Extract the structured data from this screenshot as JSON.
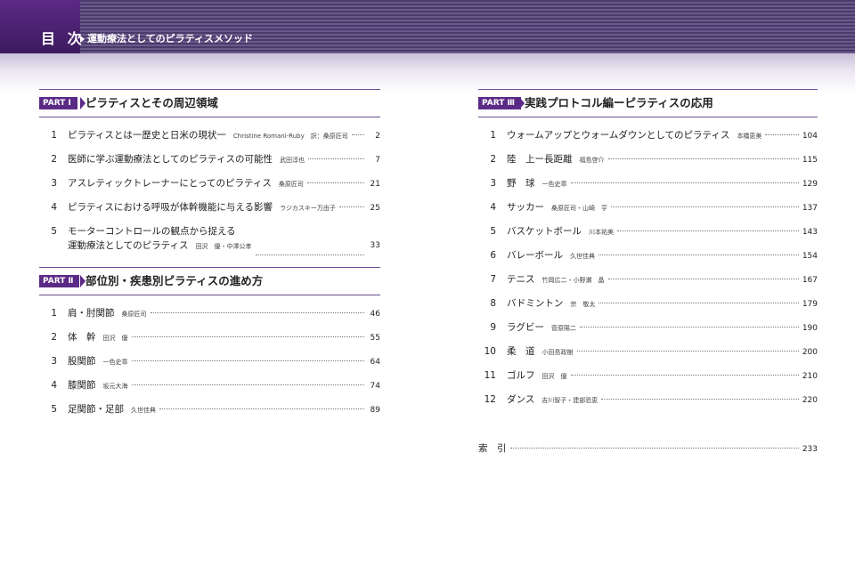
{
  "header": {
    "title": "目 次",
    "subtitle": "運動療法としてのピラティスメソッド"
  },
  "parts": {
    "p1": {
      "badge": "PART Ⅰ",
      "title": "ピラティスとその周辺領域",
      "items": [
        {
          "num": "1",
          "title": "ピラティスとは一歴史と日米の現状一",
          "author": "Christine Romani-Ruby　訳：桑原匠司",
          "page": "2"
        },
        {
          "num": "2",
          "title": "医師に学ぶ運動療法としてのピラティスの可能性",
          "author": "武田淳也",
          "page": "7"
        },
        {
          "num": "3",
          "title": "アスレティックトレーナーにとってのピラティス",
          "author": "桑原匠司",
          "page": "21"
        },
        {
          "num": "4",
          "title": "ピラティスにおける呼吸が体幹機能に与える影響",
          "author": "ラジカスキー万由子",
          "page": "25"
        },
        {
          "num": "5",
          "title": "モーターコントロールの観点から捉える",
          "title2": "運動療法としてのピラティス",
          "author": "田沢　優・中澤公孝",
          "page": "33"
        }
      ]
    },
    "p2": {
      "badge": "PART Ⅱ",
      "title": "部位別・疾患別ピラティスの進め方",
      "items": [
        {
          "num": "1",
          "title": "肩・肘関節",
          "author": "桑原匠司",
          "page": "46"
        },
        {
          "num": "2",
          "title": "体　幹",
          "author": "田沢　優",
          "page": "55"
        },
        {
          "num": "3",
          "title": "股関節",
          "author": "一色史章",
          "page": "64"
        },
        {
          "num": "4",
          "title": "膝関節",
          "author": "坂元大海",
          "page": "74"
        },
        {
          "num": "5",
          "title": "足関節・足部",
          "author": "久世佳典",
          "page": "89"
        }
      ]
    },
    "p3": {
      "badge": "PART Ⅲ",
      "title": "実践プロトコル編ーピラティスの応用",
      "items": [
        {
          "num": "1",
          "title": "ウォームアップとウォームダウンとしてのピラティス",
          "author": "本橋恵美",
          "page": "104"
        },
        {
          "num": "2",
          "title": "陸　上ー長距離",
          "author": "福島啓介",
          "page": "115"
        },
        {
          "num": "3",
          "title": "野　球",
          "author": "一色史章",
          "page": "129"
        },
        {
          "num": "4",
          "title": "サッカー",
          "author": "桑原匠司・山崎　亨",
          "page": "137"
        },
        {
          "num": "5",
          "title": "バスケットボール",
          "author": "川本祐美",
          "page": "143"
        },
        {
          "num": "6",
          "title": "バレーボール",
          "author": "久世佳典",
          "page": "154"
        },
        {
          "num": "7",
          "title": "テニス",
          "author": "竹岡広二・小野瀬　晶",
          "page": "167"
        },
        {
          "num": "8",
          "title": "バドミントン",
          "author": "宗　敬太",
          "page": "179"
        },
        {
          "num": "9",
          "title": "ラグビー",
          "author": "菅原陽二",
          "page": "190"
        },
        {
          "num": "10",
          "title": "柔　道",
          "author": "小田島政樹",
          "page": "200"
        },
        {
          "num": "11",
          "title": "ゴルフ",
          "author": "田沢　優",
          "page": "210"
        },
        {
          "num": "12",
          "title": "ダンス",
          "author": "吉川智子・建部恐恵",
          "page": "220"
        }
      ]
    }
  },
  "index": {
    "title": "索　引",
    "page": "233"
  }
}
